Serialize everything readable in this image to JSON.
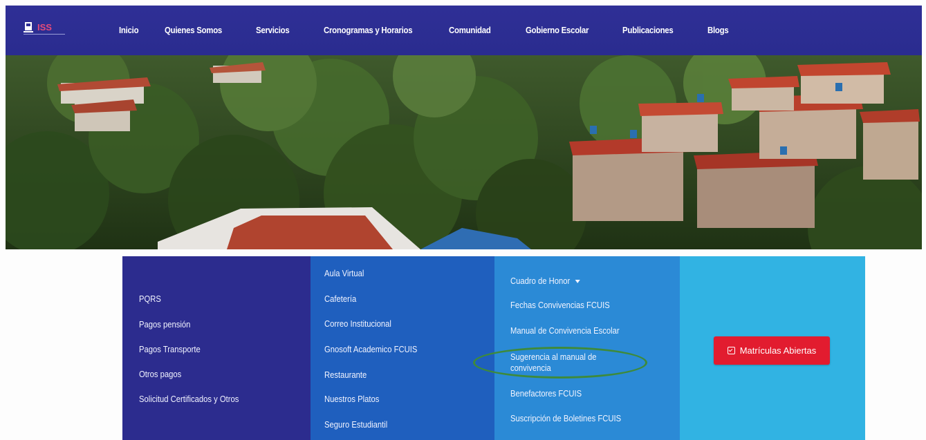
{
  "nav": {
    "logo_text": "ISS",
    "items": [
      {
        "label": "Inicio"
      },
      {
        "label": "Quienes Somos"
      },
      {
        "label": "Servicios"
      },
      {
        "label": "Cronogramas y Horarios"
      },
      {
        "label": "Comunidad"
      },
      {
        "label": "Gobierno Escolar"
      },
      {
        "label": "Publicaciones"
      },
      {
        "label": "Blogs"
      }
    ]
  },
  "footer": {
    "col1": [
      {
        "label": "PQRS"
      },
      {
        "label": "Pagos pensión"
      },
      {
        "label": "Pagos Transporte"
      },
      {
        "label": "Otros pagos"
      },
      {
        "label": "Solicitud Certificados y Otros"
      }
    ],
    "col2": [
      {
        "label": "Aula Virtual"
      },
      {
        "label": "Cafetería"
      },
      {
        "label": "Correo Institucional"
      },
      {
        "label": "Gnosoft Academico FCUIS"
      },
      {
        "label": "Restaurante"
      },
      {
        "label": "Nuestros Platos"
      },
      {
        "label": "Seguro Estudiantil"
      }
    ],
    "col3": [
      {
        "label": "Cuadro de Honor"
      },
      {
        "label": "Fechas Convivencias FCUIS"
      },
      {
        "label": "Manual de Convivencia Escolar"
      },
      {
        "label": "Sugerencia al manual de convivencia"
      },
      {
        "label": "Benefactores FCUIS"
      },
      {
        "label": "Suscripción de Boletines FCUIS"
      }
    ],
    "cta_label": "Matrículas Abiertas"
  },
  "colors": {
    "nav_bg": "#2f2f96",
    "col1_bg": "#2c2c8e",
    "col2_bg": "#1f5fbe",
    "col3_bg": "#2b8ad6",
    "col4_bg": "#31b3e3",
    "cta_bg": "#e21c2f",
    "highlight_ring": "#3e8a3b"
  }
}
